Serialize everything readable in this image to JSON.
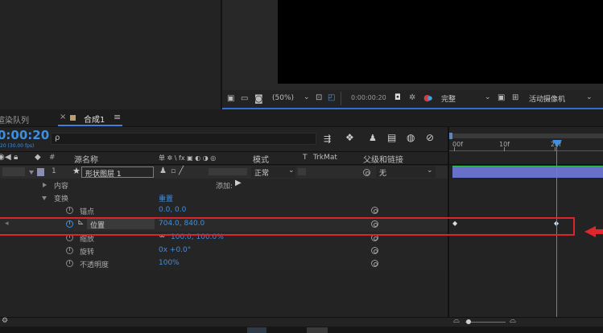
{
  "viewer": {
    "toolbar": {
      "zoom": "(50%)",
      "timecode": "0:00:00:20",
      "resolution": "完整",
      "camera": "活动摄像机"
    }
  },
  "tabs": {
    "render_queue": "渲染队列",
    "close": "×",
    "comp_tab": "合成1",
    "menu": "≡"
  },
  "timeline": {
    "current_time": "0:00:20",
    "sub_time": "20 (30.00 fps)",
    "search_icon": "ρ",
    "columns": {
      "number": "#",
      "source_name": "源名称",
      "switches": "单 ✲ \\ fx ▣ ◐ ◑ ◎",
      "mode": "模式",
      "t": "T",
      "trkmat": "TrkMat",
      "parent": "父级和链接"
    },
    "ruler": [
      "00f",
      "10f",
      "20f"
    ],
    "layer": {
      "index": "1",
      "name": "形状图层 1",
      "mode": "正常",
      "parent": "无"
    },
    "rows": {
      "contents": "内容",
      "add": "添加:",
      "transform": "变换",
      "reset": "重置",
      "anchor": {
        "label": "锚点",
        "value": "0.0, 0.0"
      },
      "position": {
        "label": "位置",
        "value": "704.0, 840.0"
      },
      "scale": {
        "label": "缩放",
        "value": "100.0, 100.0%"
      },
      "rotation": {
        "label": "旋转",
        "value": "0x +0.0°"
      },
      "opacity": {
        "label": "不透明度",
        "value": "100%"
      }
    }
  }
}
